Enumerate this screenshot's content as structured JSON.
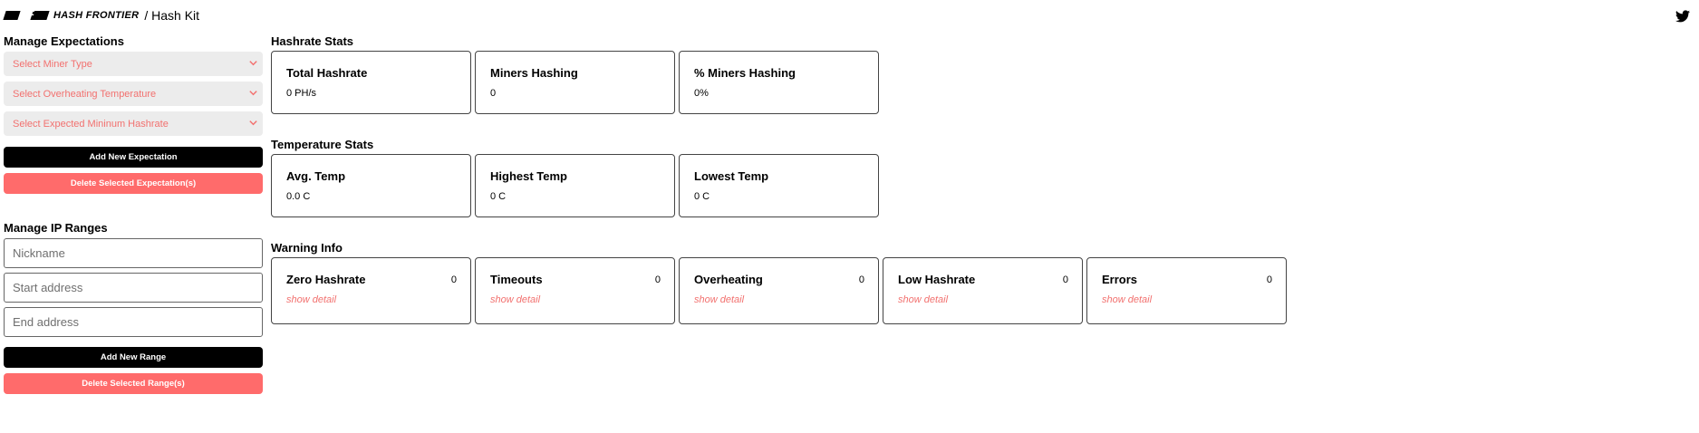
{
  "header": {
    "logo_text": "HASH FRONTIER",
    "logo_mark": "HF",
    "breadcrumb": "/ Hash Kit",
    "social_icon": "twitter-icon"
  },
  "expectations": {
    "title": "Manage Expectations",
    "selects": [
      {
        "placeholder": "Select Miner Type"
      },
      {
        "placeholder": "Select Overheating Temperature"
      },
      {
        "placeholder": "Select Expected Mininum Hashrate"
      }
    ],
    "add_label": "Add New Expectation",
    "delete_label": "Delete Selected Expectation(s)"
  },
  "ip_ranges": {
    "title": "Manage IP Ranges",
    "inputs": [
      {
        "placeholder": "Nickname"
      },
      {
        "placeholder": "Start address"
      },
      {
        "placeholder": "End address"
      }
    ],
    "add_label": "Add New Range",
    "delete_label": "Delete Selected Range(s)"
  },
  "hashrate_stats": {
    "title": "Hashrate Stats",
    "cards": [
      {
        "label": "Total Hashrate",
        "value": "0 PH/s"
      },
      {
        "label": "Miners Hashing",
        "value": "0"
      },
      {
        "label": "% Miners Hashing",
        "value": "0%"
      }
    ]
  },
  "temperature_stats": {
    "title": "Temperature Stats",
    "cards": [
      {
        "label": "Avg. Temp",
        "value": "0.0 C"
      },
      {
        "label": "Highest Temp",
        "value": "0 C"
      },
      {
        "label": "Lowest Temp",
        "value": "0 C"
      }
    ]
  },
  "warning_info": {
    "title": "Warning Info",
    "link_label": "show detail",
    "cards": [
      {
        "label": "Zero Hashrate",
        "count": "0"
      },
      {
        "label": "Timeouts",
        "count": "0"
      },
      {
        "label": "Overheating",
        "count": "0"
      },
      {
        "label": "Low Hashrate",
        "count": "0"
      },
      {
        "label": "Errors",
        "count": "0"
      }
    ]
  },
  "colors": {
    "accent_red": "#ff6b6b",
    "placeholder_red": "#f2716f",
    "select_bg": "#ececec"
  }
}
